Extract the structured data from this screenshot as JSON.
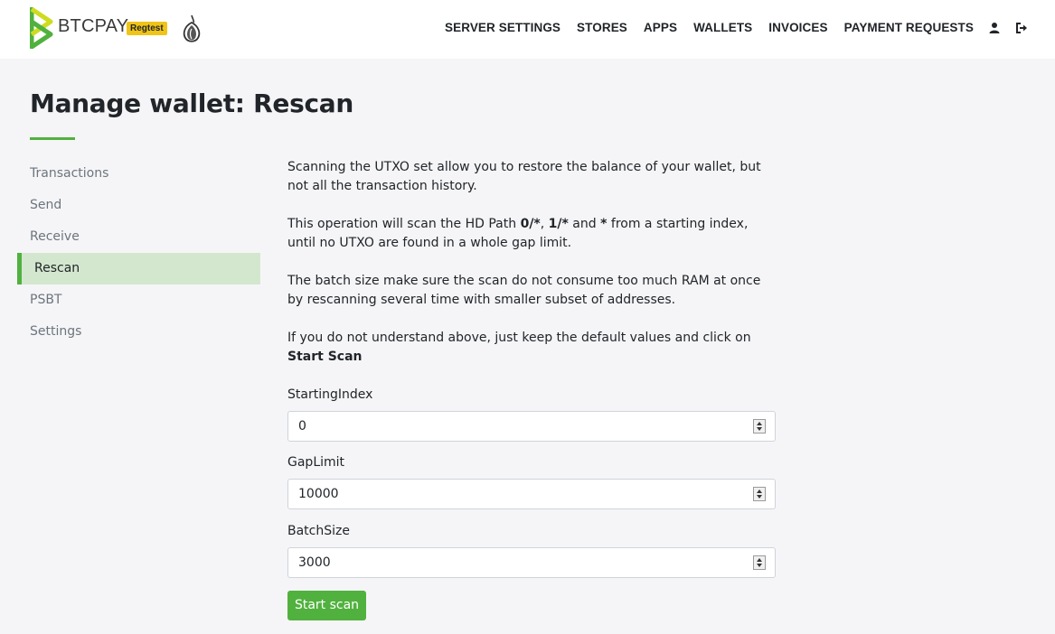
{
  "brand": {
    "name": "BTCPAY",
    "network_badge": "Regtest",
    "colors": {
      "primary": "#51b13e",
      "badge": "#f0c417",
      "active_bg": "#d3e7cf"
    }
  },
  "nav": {
    "items": [
      {
        "label": "SERVER SETTINGS"
      },
      {
        "label": "STORES"
      },
      {
        "label": "APPS"
      },
      {
        "label": "WALLETS"
      },
      {
        "label": "INVOICES"
      },
      {
        "label": "PAYMENT REQUESTS"
      }
    ],
    "icons": [
      "user-icon",
      "logout-icon"
    ]
  },
  "page": {
    "title": "Manage wallet: Rescan"
  },
  "sidebar": {
    "items": [
      {
        "label": "Transactions",
        "active": false
      },
      {
        "label": "Send",
        "active": false
      },
      {
        "label": "Receive",
        "active": false
      },
      {
        "label": "Rescan",
        "active": true
      },
      {
        "label": "PSBT",
        "active": false
      },
      {
        "label": "Settings",
        "active": false
      }
    ]
  },
  "content": {
    "p1": "Scanning the UTXO set allow you to restore the balance of your wallet, but not all the transaction history.",
    "p2_a": "This operation will scan the HD Path ",
    "p2_b": "0/*",
    "p2_c": ", ",
    "p2_d": "1/*",
    "p2_e": " and ",
    "p2_f": "*",
    "p2_g": " from a starting index, until no UTXO are found in a whole gap limit.",
    "p3": "The batch size make sure the scan do not consume too much RAM at once by rescanning several time with smaller subset of addresses.",
    "p4_a": "If you do not understand above, just keep the default values and click on ",
    "p4_b": "Start Scan"
  },
  "form": {
    "starting_index": {
      "label": "StartingIndex",
      "value": "0"
    },
    "gap_limit": {
      "label": "GapLimit",
      "value": "10000"
    },
    "batch_size": {
      "label": "BatchSize",
      "value": "3000"
    },
    "submit_label": "Start scan"
  }
}
